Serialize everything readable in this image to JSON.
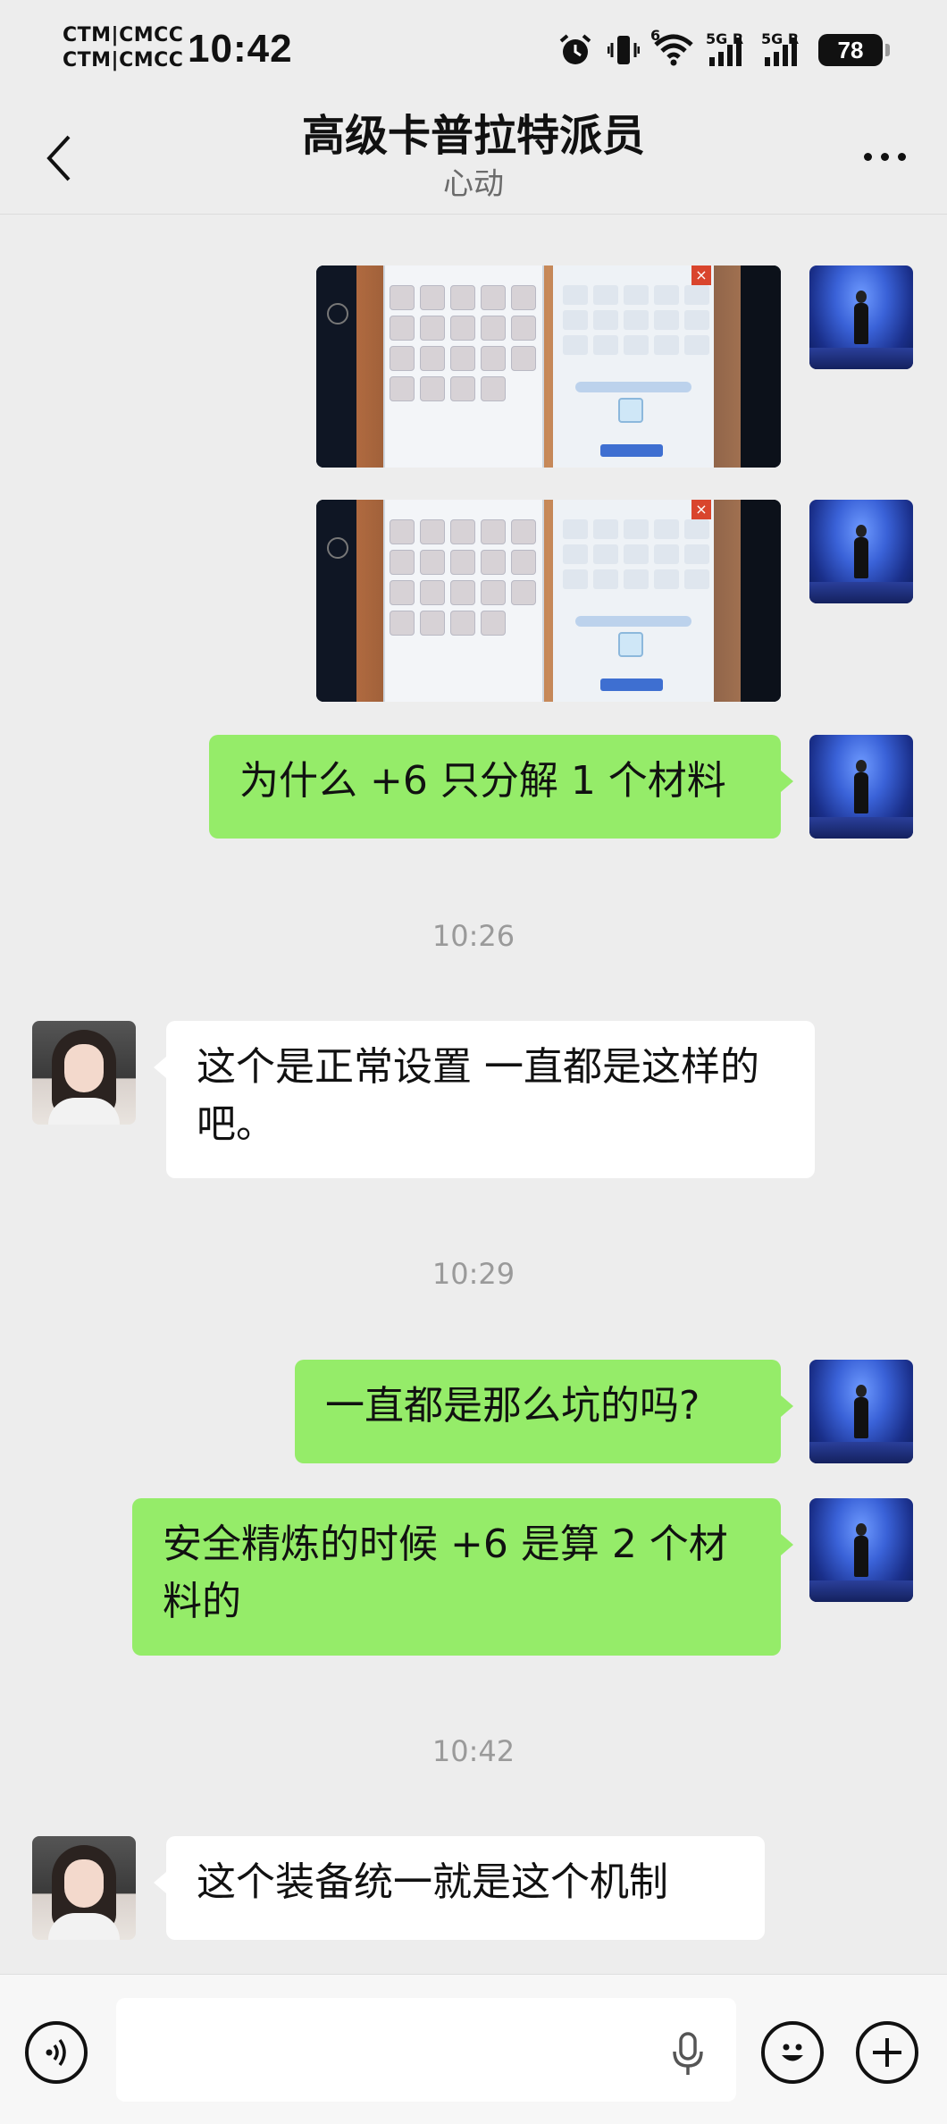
{
  "status_bar": {
    "carrier_1": "CTM|CMCC",
    "carrier_2": "CTM|CMCC",
    "time": "10:42",
    "hd_badge": "6",
    "signal_1_tag": "5G R",
    "signal_2_tag": "5G R",
    "battery": "78",
    "icons": [
      "alarm-icon",
      "vibrate-icon",
      "wifi-icon",
      "signal-icon",
      "signal-icon",
      "battery-icon"
    ]
  },
  "header": {
    "title": "高级卡普拉特派员",
    "subtitle": "心动",
    "back_icon": "chevron-left-icon",
    "more_icon": "more-horizontal-icon"
  },
  "messages": [
    {
      "type": "image",
      "sender": "self"
    },
    {
      "type": "image",
      "sender": "self"
    },
    {
      "type": "text",
      "sender": "self",
      "text": "为什么 +6 只分解 1 个材料"
    },
    {
      "type": "time",
      "text": "10:26"
    },
    {
      "type": "text",
      "sender": "other",
      "text": "这个是正常设置 一直都是这样的吧。"
    },
    {
      "type": "time",
      "text": "10:29"
    },
    {
      "type": "text",
      "sender": "self",
      "text": "一直都是那么坑的吗?"
    },
    {
      "type": "text",
      "sender": "self",
      "text": "安全精炼的时候 +6 是算 2 个材料的"
    },
    {
      "type": "time",
      "text": "10:42"
    },
    {
      "type": "text",
      "sender": "other",
      "text": "这个装备统一就是这个机制"
    }
  ],
  "input_bar": {
    "value": "",
    "placeholder": "",
    "left_icon": "voice-icon",
    "mic_icon": "mic-icon",
    "emoji_icon": "emoji-icon",
    "plus_icon": "plus-icon"
  },
  "colors": {
    "background": "#ededed",
    "self_bubble": "#95ec69",
    "other_bubble": "#ffffff",
    "timestamp": "#9a9a9a"
  }
}
